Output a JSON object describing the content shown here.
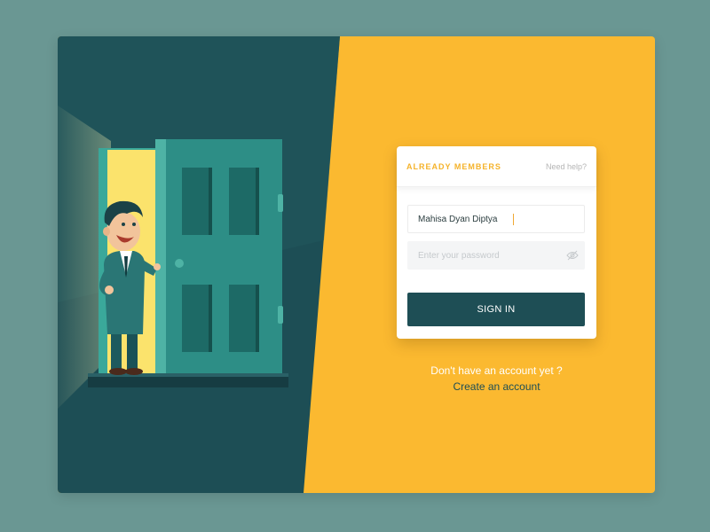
{
  "login": {
    "title": "ALREADY MEMBERS",
    "help_link": "Need help?",
    "username_value": "Mahisa Dyan Diptya",
    "password_placeholder": "Enter your password",
    "signin_label": "SIGN IN"
  },
  "signup": {
    "prompt": "Don't have an account yet ?",
    "link": "Create an account"
  },
  "colors": {
    "background": "#6a9793",
    "left_panel": "#1d4e55",
    "right_panel": "#fbb930",
    "button": "#1e4e55",
    "accent_label": "#f5b32b"
  },
  "icons": {
    "password_visibility": "eye-slash-icon"
  }
}
